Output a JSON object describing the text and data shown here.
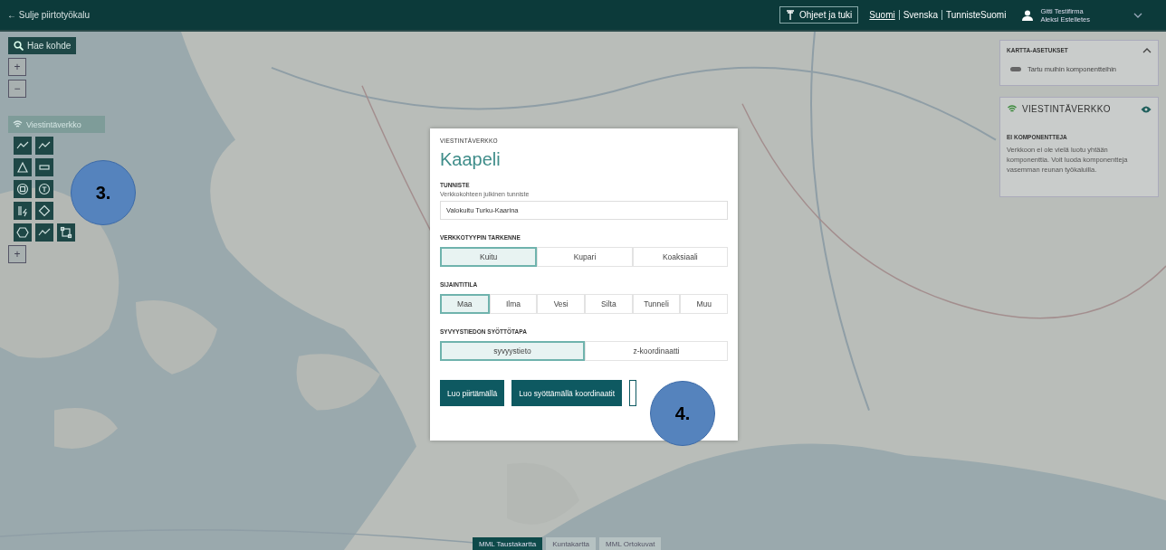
{
  "header": {
    "back_link": "← Sulje piirtotyökalu",
    "help_button": "Ohjeet ja tuki",
    "languages": [
      {
        "label": "Suomi",
        "selected": true
      },
      {
        "label": "Svenska",
        "selected": false
      },
      {
        "label": "TunnisteSuomi",
        "selected": false
      }
    ],
    "user": {
      "company": "Gitti Testifirma",
      "name": "Aleksi Estelletes"
    }
  },
  "left_tools": {
    "search_button": "Hae kohde",
    "zoom_in": "+",
    "zoom_out": "−",
    "network_button": "Viestintäverkko",
    "add_button": "+"
  },
  "map_settings": {
    "title": "KARTTA-ASETUKSET",
    "expanded": true,
    "toggle": {
      "label": "Tartu muihin komponentteihin",
      "on": false
    }
  },
  "network_panel": {
    "title": "VIESTINTÄVERKKO",
    "visible": true,
    "empty_title": "EI KOMPONENTTEJA",
    "empty_text": "Verkkoon ei ole vielä luotu yhtään komponenttia. Voit luoda komponentteja vasemman reunan työkaluilla."
  },
  "dialog": {
    "overline": "VIESTINTÄVERKKO",
    "title": "Kaapeli",
    "identifier": {
      "label": "TUNNISTE",
      "hint": "Verkkokohteen julkinen tunniste",
      "value": "Valokuitu Turku-Kaarina"
    },
    "groups": [
      {
        "label": "VERKKOTYYPIN TARKENNE",
        "options": [
          {
            "label": "Kuitu",
            "selected": true
          },
          {
            "label": "Kupari",
            "selected": false
          },
          {
            "label": "Koaksiaali",
            "selected": false
          }
        ]
      },
      {
        "label": "SIJAINTITILA",
        "options": [
          {
            "label": "Maa",
            "selected": true
          },
          {
            "label": "Ilma",
            "selected": false
          },
          {
            "label": "Vesi",
            "selected": false
          },
          {
            "label": "Silta",
            "selected": false
          },
          {
            "label": "Tunneli",
            "selected": false
          },
          {
            "label": "Muu",
            "selected": false
          }
        ]
      },
      {
        "label": "SYVYYSTIEDON SYÖTTÖTAPA",
        "options": [
          {
            "label": "syvyystieto",
            "selected": true
          },
          {
            "label": "z-koordinaatti",
            "selected": false
          }
        ]
      }
    ],
    "buttons": [
      {
        "label": "Luo piirtämällä",
        "kind": "primary"
      },
      {
        "label": "Luo syöttämällä koordinaatit",
        "kind": "primary"
      },
      {
        "kind": "outline"
      }
    ]
  },
  "callouts": [
    {
      "label": "3."
    },
    {
      "label": "4."
    }
  ],
  "base_maps": [
    {
      "label": "MML Taustakartta",
      "selected": true
    },
    {
      "label": "Kuntakartta",
      "selected": false
    },
    {
      "label": "MML Ortokuvat",
      "selected": false
    }
  ]
}
